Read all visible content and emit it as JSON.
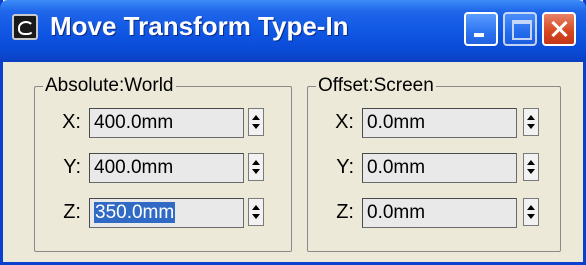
{
  "window": {
    "title": "Move Transform Type-In",
    "buttons": {
      "minimize": "minimize",
      "maximize": "maximize",
      "close": "close"
    }
  },
  "absolute": {
    "label": "Absolute:World",
    "fields": [
      {
        "axis": "X:",
        "value": "400.0mm",
        "selected": false
      },
      {
        "axis": "Y:",
        "value": "400.0mm",
        "selected": false
      },
      {
        "axis": "Z:",
        "value": "350.0mm",
        "selected": true
      }
    ]
  },
  "offset": {
    "label": "Offset:Screen",
    "fields": [
      {
        "axis": "X:",
        "value": "0.0mm"
      },
      {
        "axis": "Y:",
        "value": "0.0mm"
      },
      {
        "axis": "Z:",
        "value": "0.0mm"
      }
    ]
  },
  "colors": {
    "titlebar": "#0e55e2",
    "window_bg": "#ece9d8",
    "selection": "#316ac5",
    "close_button": "#d6461e"
  }
}
